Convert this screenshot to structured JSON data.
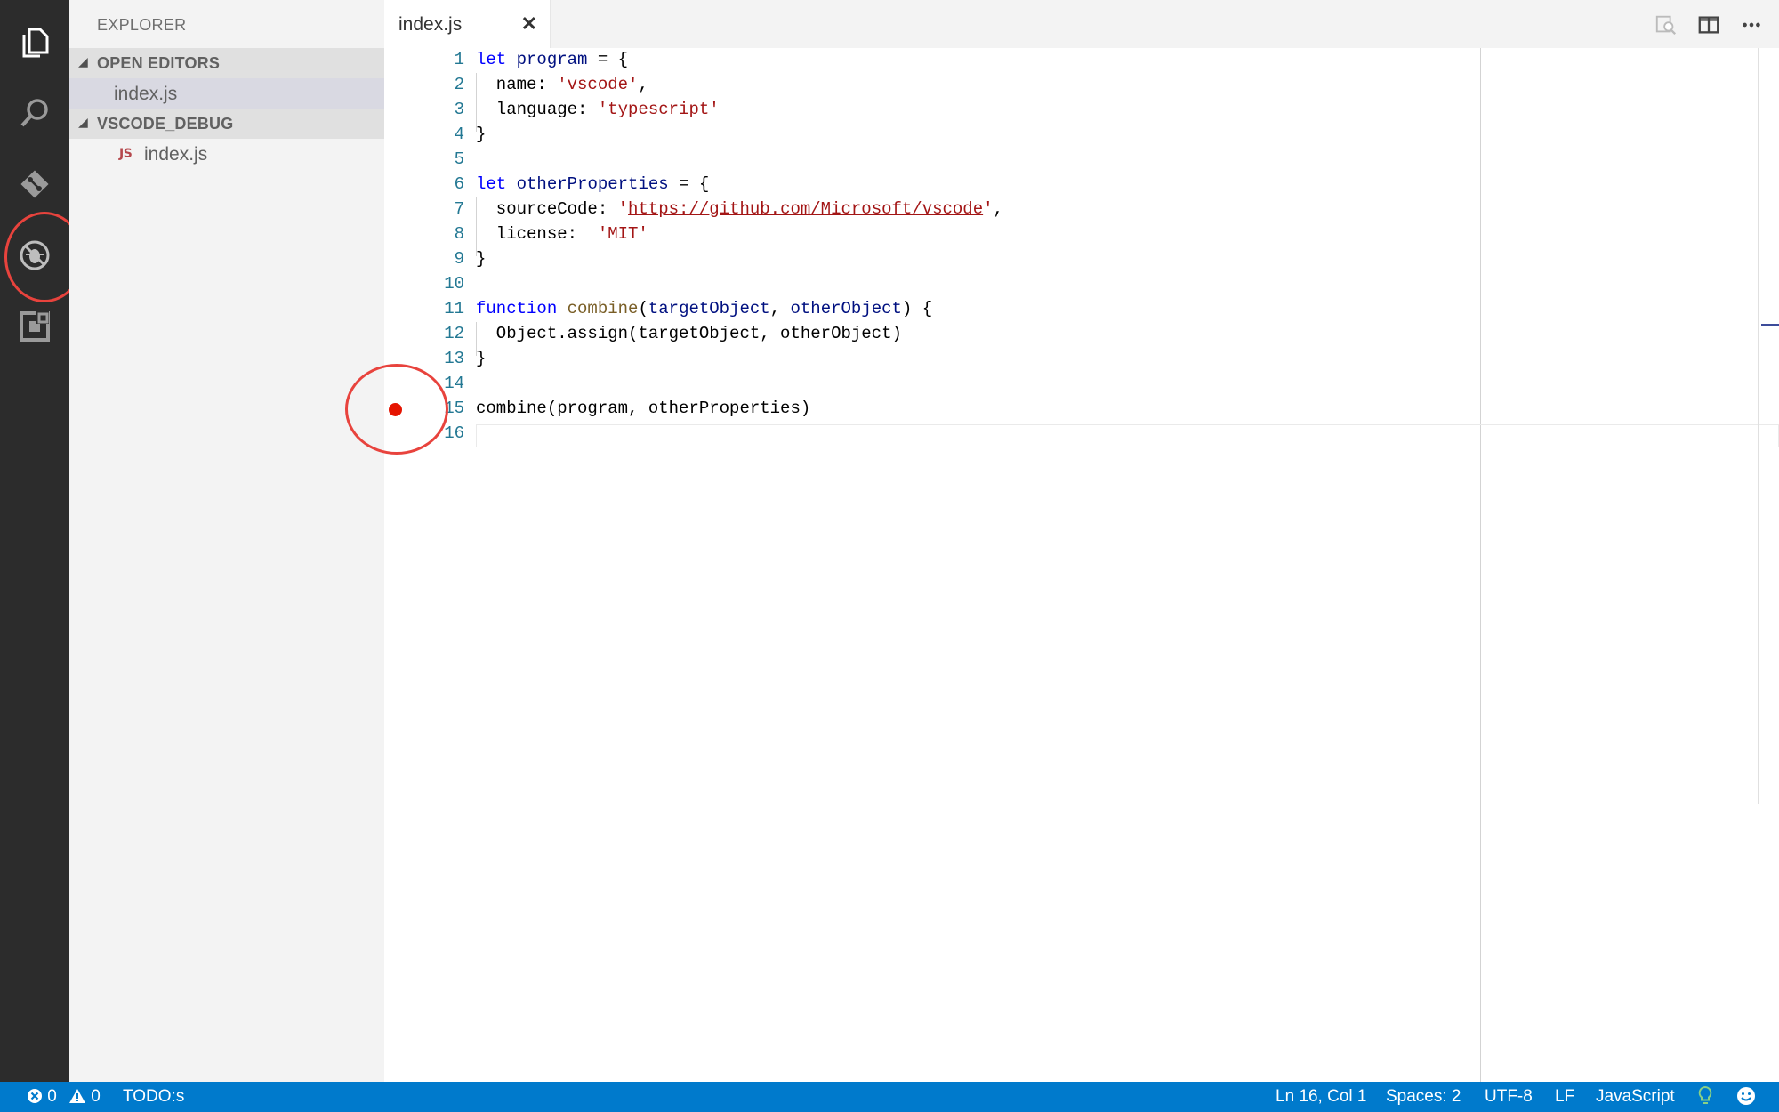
{
  "sidebar": {
    "title": "EXPLORER",
    "sections": [
      {
        "label": "OPEN EDITORS",
        "items": [
          {
            "label": "index.js"
          }
        ]
      },
      {
        "label": "VSCODE_DEBUG",
        "items": [
          {
            "label": "index.js",
            "badge": "JS"
          }
        ]
      }
    ]
  },
  "tabs": [
    {
      "label": "index.js",
      "close": "✕"
    }
  ],
  "editor": {
    "lines": [
      "1",
      "2",
      "3",
      "4",
      "5",
      "6",
      "7",
      "8",
      "9",
      "10",
      "11",
      "12",
      "13",
      "14",
      "15",
      "16"
    ],
    "code": {
      "l1": {
        "kw": "let",
        "var": "program",
        "rest": " = {"
      },
      "l2": {
        "key": "  name: ",
        "str": "'vscode'",
        "rest": ","
      },
      "l3": {
        "key": "  language: ",
        "str": "'typescript'"
      },
      "l4": "}",
      "l6": {
        "kw": "let",
        "var": "otherProperties",
        "rest": " = {"
      },
      "l7": {
        "key": "  sourceCode: ",
        "q1": "'",
        "link": "https://github.com/Microsoft/vscode",
        "q2": "'",
        "rest": ","
      },
      "l8": {
        "key": "  license:  ",
        "str": "'MIT'"
      },
      "l9": "}",
      "l11": {
        "kw": "function",
        "fn": "combine",
        "p": "(",
        "a1": "targetObject",
        "c": ", ",
        "a2": "otherObject",
        "rest": ") {"
      },
      "l12": "  Object.assign(targetObject, otherObject)",
      "l13": "}",
      "l15": "combine(program, otherProperties)"
    },
    "breakpoint_line": 15
  },
  "status": {
    "errors": "0",
    "warnings": "0",
    "todo": "TODO:s",
    "position": "Ln 16, Col 1",
    "spaces": "Spaces: 2",
    "encoding": "UTF-8",
    "eol": "LF",
    "language": "JavaScript"
  },
  "colors": {
    "activity_bar": "#2c2c2c",
    "status_bar": "#007acc",
    "annotation": "#e8433d",
    "breakpoint": "#e51400"
  }
}
